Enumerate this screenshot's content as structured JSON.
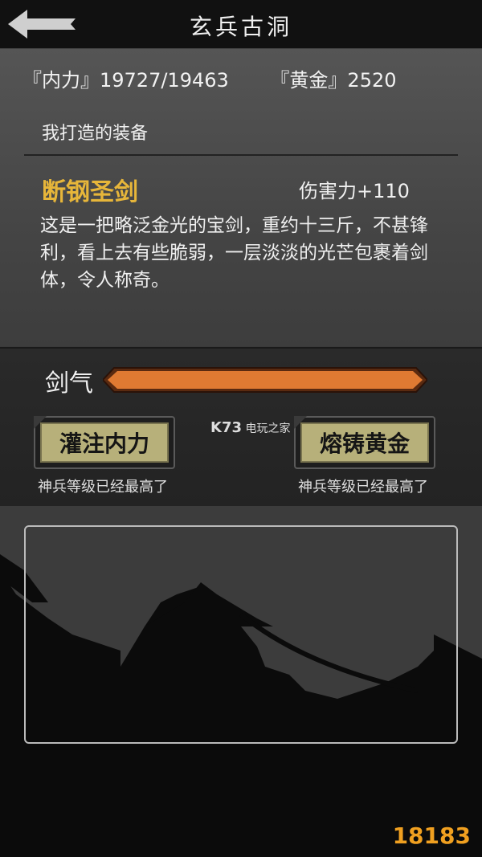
{
  "header": {
    "title": "玄兵古洞",
    "back_icon": "back-arrow-icon"
  },
  "stats": {
    "neili_label": "『内力』",
    "neili_value": "19727/19463",
    "gold_label": "『黄金』",
    "gold_value": "2520"
  },
  "section": {
    "label": "我打造的装备"
  },
  "item": {
    "name": "断钢圣剑",
    "damage": "伤害力+110",
    "description": "这是一把略泛金光的宝剑，重约十三斤，不甚锋利，看上去有些脆弱，一层淡淡的光芒包裹着剑体，令人称奇。"
  },
  "sword_qi": {
    "label": "剑气",
    "fill": 1.0,
    "color": "#e07a32"
  },
  "actions": {
    "inject": {
      "label": "灌注内力",
      "note": "神兵等级已经最高了"
    },
    "cast": {
      "label": "熔铸黄金",
      "note": "神兵等级已经最高了"
    }
  },
  "watermark": {
    "center_text": "K73",
    "center_small": "电玩之家 .com",
    "corner": "18183"
  },
  "colors": {
    "gold_text": "#e7b63a",
    "button_face": "#b7b07a",
    "bar": "#e07a32"
  }
}
